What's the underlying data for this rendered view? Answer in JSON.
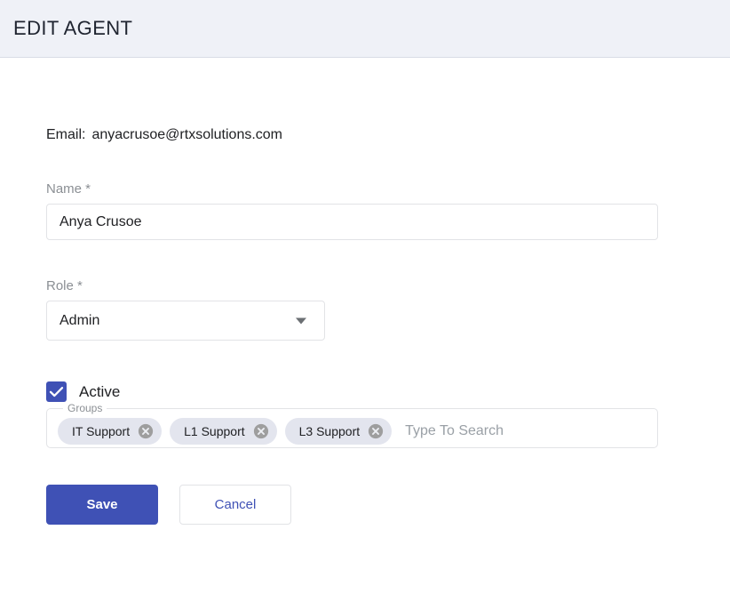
{
  "header": {
    "title": "EDIT AGENT"
  },
  "form": {
    "email": {
      "label": "Email:",
      "value": "anyacrusoe@rtxsolutions.com"
    },
    "name": {
      "label": "Name *",
      "value": "Anya Crusoe",
      "placeholder": ""
    },
    "role": {
      "label": "Role *",
      "selected": "Admin",
      "icon": "chevron-down-icon"
    },
    "active": {
      "label": "Active",
      "checked": true,
      "icon": "checkmark-icon"
    },
    "groups": {
      "legend": "Groups",
      "chips": [
        {
          "label": "IT Support",
          "remove_icon": "close-circle-icon"
        },
        {
          "label": "L1 Support",
          "remove_icon": "close-circle-icon"
        },
        {
          "label": "L3 Support",
          "remove_icon": "close-circle-icon"
        }
      ],
      "search_placeholder": "Type To Search",
      "search_value": ""
    }
  },
  "actions": {
    "save_label": "Save",
    "cancel_label": "Cancel"
  },
  "colors": {
    "accent": "#3f51b5",
    "header_bg": "#eff1f7",
    "chip_bg": "#e3e5ee",
    "border": "#e2e3e6",
    "muted_text": "#8b8f94"
  }
}
